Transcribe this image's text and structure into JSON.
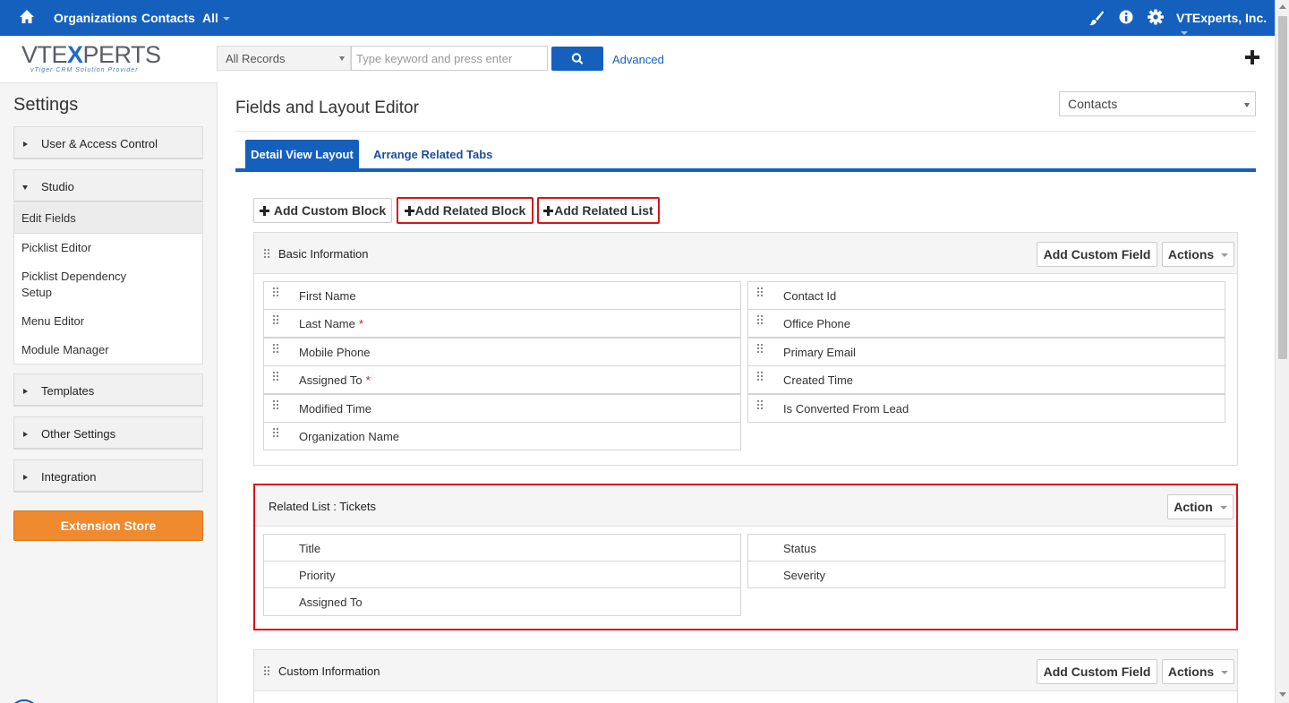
{
  "topbar": {
    "nav": [
      "Organizations",
      "Contacts",
      "All"
    ],
    "company": "VTExperts, Inc."
  },
  "logo": {
    "brand": "VTEXPERTS",
    "tagline": "vTiger CRM Solution Provider"
  },
  "search": {
    "scope": "All Records",
    "placeholder": "Type keyword and press enter",
    "advanced": "Advanced"
  },
  "sidebar": {
    "title": "Settings",
    "blocks": [
      "User & Access Control",
      "Studio",
      "Templates",
      "Other Settings",
      "Integration"
    ],
    "studio_items": [
      "Edit Fields",
      "Picklist Editor",
      "Picklist Dependency",
      "Setup",
      "Menu Editor",
      "Module Manager"
    ],
    "extension_store": "Extension Store"
  },
  "main": {
    "title": "Fields and Layout Editor",
    "module": "Contacts",
    "tabs": [
      "Detail View Layout",
      "Arrange Related Tabs"
    ],
    "buttons": {
      "add_custom_block": "Add Custom Block",
      "add_related_block": "Add Related Block",
      "add_related_list": "Add Related List"
    },
    "basic": {
      "title": "Basic Information",
      "add_field": "Add Custom Field",
      "actions": "Actions",
      "left": [
        "First Name",
        "Last Name",
        "Mobile Phone",
        "Assigned To",
        "Modified Time",
        "Organization Name"
      ],
      "right": [
        "Contact Id",
        "Office Phone",
        "Primary Email",
        "Created Time",
        "Is Converted From Lead"
      ],
      "required_mark": "*"
    },
    "related": {
      "title": "Related List : Tickets",
      "action": "Action",
      "left": [
        "Title",
        "Priority",
        "Assigned To"
      ],
      "right": [
        "Status",
        "Severity"
      ]
    },
    "custom": {
      "title": "Custom Information",
      "add_field": "Add Custom Field",
      "actions": "Actions"
    }
  },
  "colors": {
    "primary": "#1560bd",
    "highlight": "#d9121b",
    "extension": "#ef8a2e"
  }
}
